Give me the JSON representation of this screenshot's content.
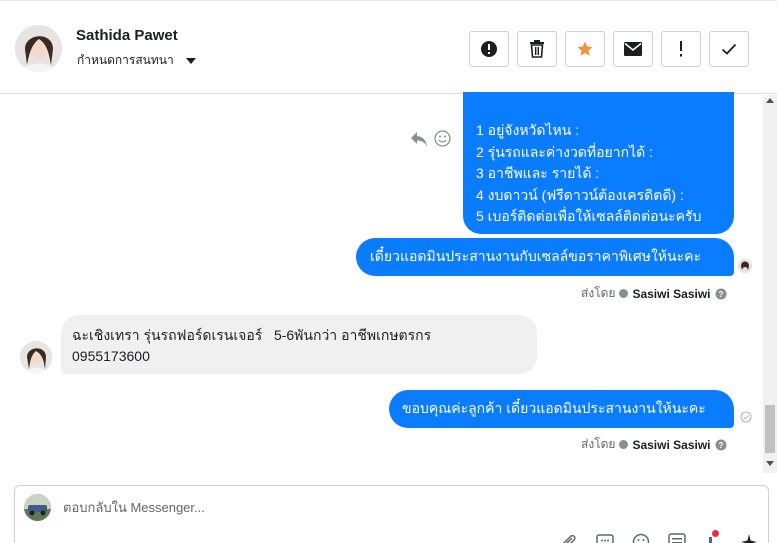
{
  "header": {
    "contact_name": "Sathida Pawet",
    "assign_label": "กำหนดการสนทนา",
    "actions": [
      {
        "name": "mark-spam-button",
        "icon": "alert-circle-icon"
      },
      {
        "name": "delete-button",
        "icon": "trash-icon"
      },
      {
        "name": "star-button",
        "icon": "star-icon"
      },
      {
        "name": "mark-unread-button",
        "icon": "envelope-icon"
      },
      {
        "name": "follow-up-button",
        "icon": "exclamation-icon"
      },
      {
        "name": "mark-done-button",
        "icon": "check-icon"
      }
    ]
  },
  "messages": {
    "outgoing_list": {
      "lines": [
        "1 อยู่จังหวัดไหน :",
        " 2 รุ่นรถและค่างวดที่อยากได้ :",
        " 3 อาชีพและ รายได้ :",
        "4 งบดาวน์ (ฟรีดาวน์ต้องเครดิตดี) :",
        "5 เบอร์ติดต่อเพื่อให้เซลล์ติดต่อนะครับ"
      ]
    },
    "outgoing_1": {
      "text": "เดี๋ยวแอดมินประสานงานกับเซลล์ขอราคาพิเศษให้นะคะ"
    },
    "sent_by_1": {
      "prefix": "ส่งโดย",
      "sender": "Sasiwi Sasiwi"
    },
    "incoming_1": {
      "line1": "ฉะเชิงเทรา รุ่นรถฟอร์ดเรนเจอร์   5-6พันกว่า อาชีพเกษตรกร",
      "line2": "0955173600"
    },
    "outgoing_2": {
      "text": "ขอบคุณค่ะลูกค้า เดี๋ยวแอดมินประสานงานให้นะคะ"
    },
    "sent_by_2": {
      "prefix": "ส่งโดย",
      "sender": "Sasiwi Sasiwi"
    }
  },
  "composer": {
    "placeholder": "ตอบกลับใน Messenger..."
  },
  "colors": {
    "brand_blue": "#0a7cff",
    "star_orange": "#f7923b",
    "incoming_bg": "#f0f0f0"
  }
}
